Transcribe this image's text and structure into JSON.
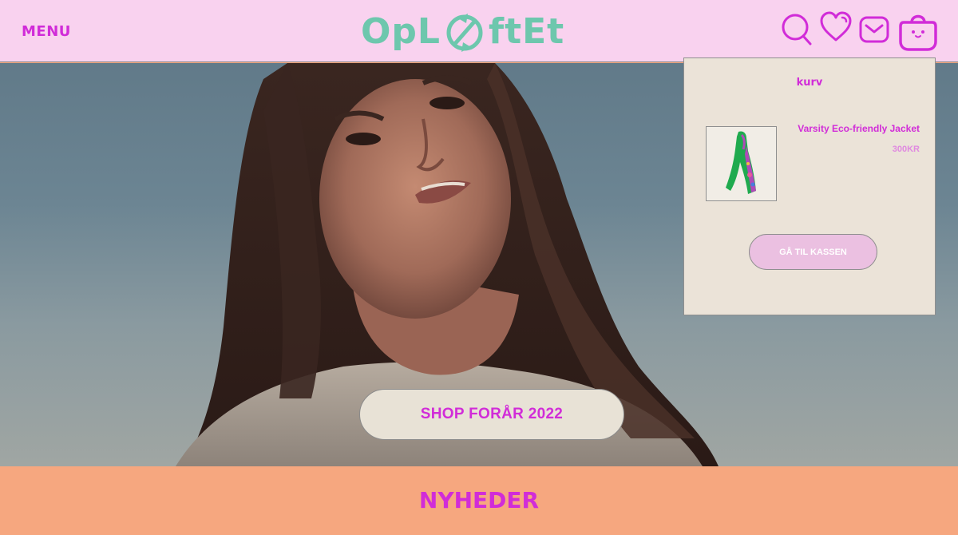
{
  "header": {
    "menu_label": "MENU",
    "logo_text_left": "OpL",
    "logo_text_right": "ftEt",
    "icons": [
      "search-icon",
      "heart-icon",
      "mail-icon",
      "shopping-bag-icon"
    ]
  },
  "hero": {
    "shop_button_label": "SHOP FORÅR 2022"
  },
  "cart": {
    "title": "kurv",
    "item": {
      "name": "Varsity Eco-friendly Jacket",
      "price": "300KR"
    },
    "checkout_label": "GÅ TIL KASSEN"
  },
  "news": {
    "title": "NYHEDER"
  },
  "colors": {
    "accent": "#d12cd8",
    "header_bg": "#f9d2ef",
    "logo": "#6dc7ad",
    "cart_bg": "#ebe3d8",
    "button_bg": "#e8e2d6",
    "checkout_bg": "#ebc0e1",
    "footer_bg": "#f6a77f"
  }
}
